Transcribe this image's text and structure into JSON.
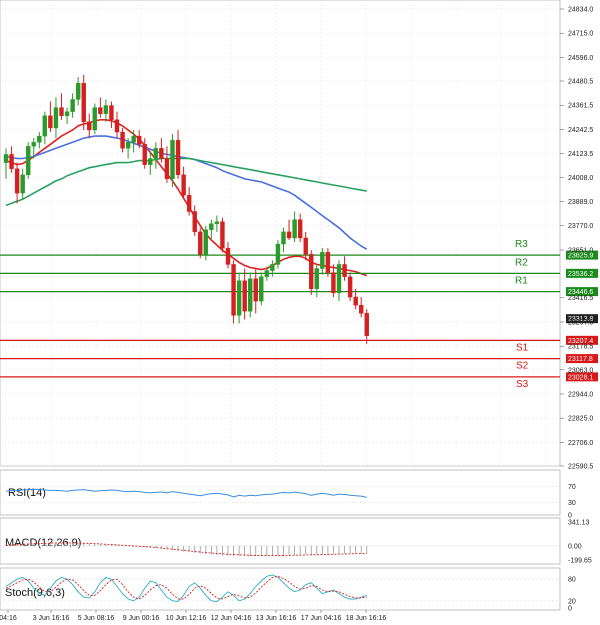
{
  "chart_data": {
    "type": "candlestick",
    "y_axis_labels": [
      "24834.0",
      "24715.0",
      "24596.0",
      "24480.5",
      "24361.5",
      "24242.5",
      "24123.5",
      "24008.0",
      "23889.0",
      "23770.0",
      "23651.0",
      "23416.5",
      "23297.5",
      "23178.5",
      "23063.0",
      "22944.0",
      "22825.0",
      "22706.0",
      "22590.5"
    ],
    "x_labels": [
      "04:16",
      "3 Jun 16:16",
      "5 Jun 08:16",
      "9 Jun 00:16",
      "10 Jun 12:16",
      "12 Jun 04:16",
      "13 Jun 16:16",
      "17 Jun 04:16",
      "18 Jun 16:16"
    ],
    "candles": [
      [
        24080,
        24150,
        24000,
        24120
      ],
      [
        24120,
        24160,
        24030,
        24050
      ],
      [
        24050,
        24080,
        23880,
        23930
      ],
      [
        23930,
        24050,
        23900,
        24020
      ],
      [
        24020,
        24180,
        24000,
        24160
      ],
      [
        24160,
        24200,
        24100,
        24180
      ],
      [
        24180,
        24230,
        24150,
        24210
      ],
      [
        24210,
        24330,
        24170,
        24310
      ],
      [
        24310,
        24380,
        24230,
        24250
      ],
      [
        24250,
        24400,
        24200,
        24350
      ],
      [
        24350,
        24420,
        24290,
        24310
      ],
      [
        24310,
        24350,
        24270,
        24330
      ],
      [
        24330,
        24420,
        24300,
        24390
      ],
      [
        24390,
        24500,
        24360,
        24470
      ],
      [
        24470,
        24510,
        24240,
        24280
      ],
      [
        24280,
        24320,
        24200,
        24240
      ],
      [
        24240,
        24370,
        24220,
        24350
      ],
      [
        24350,
        24400,
        24300,
        24320
      ],
      [
        24320,
        24390,
        24280,
        24360
      ],
      [
        24360,
        24380,
        24250,
        24290
      ],
      [
        24290,
        24330,
        24200,
        24230
      ],
      [
        24230,
        24250,
        24130,
        24150
      ],
      [
        24150,
        24200,
        24100,
        24180
      ],
      [
        24180,
        24240,
        24130,
        24210
      ],
      [
        24210,
        24240,
        24150,
        24170
      ],
      [
        24170,
        24200,
        24050,
        24070
      ],
      [
        24070,
        24130,
        24020,
        24100
      ],
      [
        24100,
        24180,
        24050,
        24150
      ],
      [
        24150,
        24200,
        24080,
        24100
      ],
      [
        24100,
        24160,
        23980,
        24000
      ],
      [
        24000,
        24220,
        23960,
        24190
      ],
      [
        24190,
        24240,
        24000,
        24020
      ],
      [
        24020,
        24060,
        23900,
        23920
      ],
      [
        23920,
        23960,
        23820,
        23840
      ],
      [
        23840,
        23870,
        23720,
        23740
      ],
      [
        23740,
        23760,
        23610,
        23630
      ],
      [
        23630,
        23770,
        23600,
        23750
      ],
      [
        23750,
        23800,
        23700,
        23780
      ],
      [
        23780,
        23820,
        23740,
        23790
      ],
      [
        23790,
        23810,
        23640,
        23660
      ],
      [
        23660,
        23690,
        23560,
        23580
      ],
      [
        23580,
        23600,
        23290,
        23330
      ],
      [
        23330,
        23540,
        23290,
        23500
      ],
      [
        23500,
        23560,
        23310,
        23350
      ],
      [
        23350,
        23540,
        23320,
        23510
      ],
      [
        23510,
        23560,
        23340,
        23400
      ],
      [
        23400,
        23540,
        23380,
        23520
      ],
      [
        23520,
        23570,
        23500,
        23550
      ],
      [
        23550,
        23600,
        23520,
        23580
      ],
      [
        23580,
        23700,
        23560,
        23680
      ],
      [
        23680,
        23760,
        23640,
        23740
      ],
      [
        23740,
        23800,
        23700,
        23710
      ],
      [
        23710,
        23840,
        23690,
        23800
      ],
      [
        23800,
        23830,
        23690,
        23710
      ],
      [
        23710,
        23740,
        23600,
        23630
      ],
      [
        23630,
        23650,
        23430,
        23460
      ],
      [
        23460,
        23580,
        23420,
        23560
      ],
      [
        23560,
        23660,
        23530,
        23640
      ],
      [
        23640,
        23660,
        23520,
        23540
      ],
      [
        23540,
        23580,
        23420,
        23440
      ],
      [
        23440,
        23600,
        23400,
        23580
      ],
      [
        23580,
        23620,
        23500,
        23520
      ],
      [
        23520,
        23540,
        23400,
        23420
      ],
      [
        23420,
        23460,
        23360,
        23380
      ],
      [
        23380,
        23420,
        23320,
        23340
      ],
      [
        23340,
        23360,
        23190,
        23230
      ]
    ],
    "series": [
      {
        "color": "#e02020",
        "values": [
          24090,
          24080,
          24070,
          24075,
          24090,
          24110,
          24130,
          24150,
          24170,
          24190,
          24210,
          24225,
          24240,
          24260,
          24270,
          24275,
          24285,
          24290,
          24290,
          24285,
          24275,
          24260,
          24240,
          24220,
          24195,
          24165,
          24130,
          24095,
          24060,
          24025,
          23990,
          23950,
          23905,
          23860,
          23815,
          23770,
          23730,
          23700,
          23675,
          23650,
          23630,
          23610,
          23590,
          23575,
          23565,
          23560,
          23555,
          23560,
          23575,
          23590,
          23605,
          23615,
          23620,
          23620,
          23610,
          23590,
          23580,
          23575,
          23570,
          23565,
          23560,
          23555,
          23550,
          23545,
          23535,
          23525
        ]
      },
      {
        "color": "#4a6fe0",
        "values": [
          24110,
          24105,
          24100,
          24100,
          24105,
          24110,
          24120,
          24130,
          24140,
          24150,
          24160,
          24170,
          24180,
          24190,
          24200,
          24205,
          24210,
          24210,
          24210,
          24205,
          24200,
          24195,
          24185,
          24175,
          24165,
          24155,
          24145,
          24135,
          24125,
          24120,
          24115,
          24110,
          24105,
          24100,
          24095,
          24085,
          24075,
          24065,
          24055,
          24040,
          24030,
          24020,
          24010,
          24000,
          23995,
          23990,
          23985,
          23975,
          23965,
          23955,
          23945,
          23935,
          23920,
          23900,
          23880,
          23860,
          23840,
          23820,
          23800,
          23780,
          23760,
          23735,
          23710,
          23690,
          23670,
          23655
        ]
      },
      {
        "color": "#2aa060",
        "values": [
          23870,
          23880,
          23890,
          23900,
          23915,
          23930,
          23945,
          23960,
          23975,
          23990,
          24000,
          24015,
          24025,
          24035,
          24045,
          24055,
          24060,
          24065,
          24070,
          24075,
          24080,
          24080,
          24080,
          24085,
          24090,
          24090,
          24090,
          24095,
          24100,
          24100,
          24100,
          24100,
          24100,
          24100,
          24095,
          24090,
          24085,
          24080,
          24075,
          24070,
          24065,
          24060,
          24055,
          24050,
          24045,
          24040,
          24035,
          24030,
          24025,
          24020,
          24015,
          24010,
          24005,
          24000,
          23995,
          23990,
          23985,
          23980,
          23975,
          23970,
          23965,
          23960,
          23955,
          23950,
          23945,
          23940
        ]
      }
    ],
    "levels": [
      {
        "label": "R3",
        "value": "23625.9",
        "num": 23625.9,
        "color": "#1a8a1a"
      },
      {
        "label": "R2",
        "value": "23536.2",
        "num": 23536.2,
        "color": "#1a8a1a"
      },
      {
        "label": "R1",
        "value": "23446.6",
        "num": 23446.6,
        "color": "#1a8a1a"
      },
      {
        "label": "S1",
        "value": "23207.4",
        "num": 23207.4,
        "color": "#d81818"
      },
      {
        "label": "S2",
        "value": "23117.8",
        "num": 23117.8,
        "color": "#d81818"
      },
      {
        "label": "S3",
        "value": "23028.1",
        "num": 23028.1,
        "color": "#d81818"
      }
    ],
    "last_price": "23313.8",
    "rsi": {
      "title": "RSI(14)",
      "levels": [
        "70",
        "30",
        "0"
      ],
      "values": [
        58,
        60,
        59,
        61,
        62,
        63,
        62,
        61,
        60,
        60,
        59,
        58,
        60,
        61,
        62,
        60,
        58,
        59,
        60,
        61,
        60,
        58,
        57,
        58,
        57,
        55,
        54,
        55,
        56,
        54,
        57,
        55,
        53,
        51,
        49,
        47,
        50,
        52,
        53,
        51,
        49,
        44,
        48,
        46,
        48,
        47,
        49,
        50,
        51,
        53,
        55,
        54,
        56,
        54,
        52,
        48,
        51,
        53,
        51,
        48,
        51,
        50,
        48,
        47,
        46,
        43
      ]
    },
    "macd": {
      "title": "MACD(12,26,9)",
      "levels": [
        "341.13",
        "0.00",
        "-199.65"
      ],
      "hist": [
        10,
        15,
        20,
        25,
        30,
        35,
        40,
        40,
        42,
        45,
        45,
        44,
        42,
        40,
        38,
        35,
        30,
        25,
        20,
        15,
        10,
        5,
        0,
        -5,
        -10,
        -15,
        -20,
        -30,
        -40,
        -50,
        -60,
        -70,
        -80,
        -90,
        -100,
        -110,
        -120,
        -125,
        -130,
        -135,
        -140,
        -142,
        -144,
        -145,
        -145,
        -144,
        -143,
        -142,
        -140,
        -138,
        -135,
        -132,
        -130,
        -128,
        -125,
        -122,
        -120,
        -117,
        -115,
        -113,
        -110,
        -108,
        -106,
        -104,
        -102,
        -100
      ],
      "signal": [
        5,
        12,
        18,
        22,
        28,
        32,
        36,
        38,
        40,
        42,
        43,
        43,
        42,
        41,
        39,
        37,
        33,
        29,
        24,
        20,
        15,
        10,
        5,
        0,
        -5,
        -10,
        -15,
        -22,
        -30,
        -38,
        -46,
        -54,
        -62,
        -70,
        -78,
        -86,
        -94,
        -100,
        -106,
        -112,
        -118,
        -122,
        -126,
        -130,
        -133,
        -135,
        -136,
        -137,
        -137,
        -136,
        -135,
        -134,
        -132,
        -130,
        -128,
        -126,
        -124,
        -122,
        -120,
        -118,
        -116,
        -114,
        -112,
        -110,
        -108,
        -106
      ]
    },
    "stoch": {
      "title": "Stoch(9,6,3)",
      "levels": [
        "80",
        "20",
        "0"
      ],
      "k": [
        60,
        70,
        80,
        85,
        75,
        55,
        40,
        35,
        55,
        75,
        85,
        80,
        65,
        45,
        30,
        28,
        45,
        70,
        85,
        80,
        60,
        40,
        25,
        20,
        30,
        55,
        75,
        70,
        50,
        30,
        20,
        18,
        35,
        60,
        70,
        55,
        35,
        20,
        18,
        30,
        45,
        35,
        20,
        25,
        40,
        60,
        75,
        88,
        92,
        85,
        70,
        55,
        45,
        50,
        65,
        70,
        55,
        40,
        45,
        50,
        40,
        30,
        25,
        25,
        30,
        35
      ],
      "d": [
        55,
        62,
        70,
        78,
        80,
        72,
        58,
        45,
        45,
        58,
        72,
        80,
        78,
        65,
        48,
        35,
        35,
        48,
        65,
        78,
        80,
        65,
        45,
        30,
        25,
        35,
        50,
        62,
        65,
        55,
        38,
        25,
        25,
        38,
        55,
        62,
        55,
        40,
        28,
        25,
        32,
        38,
        33,
        28,
        30,
        42,
        58,
        72,
        85,
        88,
        82,
        72,
        60,
        52,
        55,
        62,
        60,
        50,
        45,
        47,
        45,
        38,
        32,
        28,
        28,
        30
      ]
    }
  }
}
